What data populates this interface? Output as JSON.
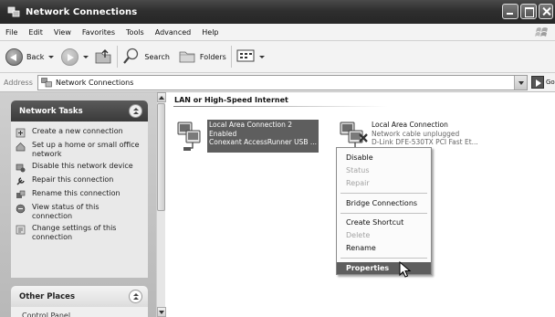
{
  "window": {
    "title": "Network Connections"
  },
  "menubar": {
    "items": [
      "File",
      "Edit",
      "View",
      "Favorites",
      "Tools",
      "Advanced",
      "Help"
    ]
  },
  "toolbar": {
    "back_label": "Back",
    "search_label": "Search",
    "folders_label": "Folders"
  },
  "address": {
    "label": "Address",
    "value": "Network Connections",
    "go_label": "Go"
  },
  "left": {
    "tasks_title": "Network Tasks",
    "tasks": [
      {
        "label": "Create a new connection",
        "icon": "new-connection-icon"
      },
      {
        "label": "Set up a home or small office network",
        "icon": "home-network-icon"
      },
      {
        "label": "Disable this network device",
        "icon": "disable-device-icon"
      },
      {
        "label": "Repair this connection",
        "icon": "repair-icon"
      },
      {
        "label": "Rename this connection",
        "icon": "rename-icon"
      },
      {
        "label": "View status of this connection",
        "icon": "status-icon"
      },
      {
        "label": "Change settings of this connection",
        "icon": "settings-icon"
      }
    ],
    "other_title": "Other Places",
    "other_first": "Control Panel"
  },
  "content": {
    "group_header": "LAN or High-Speed Internet",
    "connections": [
      {
        "name": "Local Area Connection 2",
        "status": "Enabled",
        "device": "Conexant AccessRunner USB ..."
      },
      {
        "name": "Local Area Connection",
        "status": "Network cable unplugged",
        "device": "D-Link DFE-530TX PCI Fast Et..."
      }
    ]
  },
  "context_menu": {
    "items": [
      {
        "label": "Disable",
        "enabled": true
      },
      {
        "label": "Status",
        "enabled": false
      },
      {
        "label": "Repair",
        "enabled": false
      },
      {
        "label": "Bridge Connections",
        "enabled": true
      },
      {
        "label": "Create Shortcut",
        "enabled": true
      },
      {
        "label": "Delete",
        "enabled": false
      },
      {
        "label": "Rename",
        "enabled": true
      },
      {
        "label": "Properties",
        "enabled": true,
        "highlighted": true
      }
    ]
  }
}
